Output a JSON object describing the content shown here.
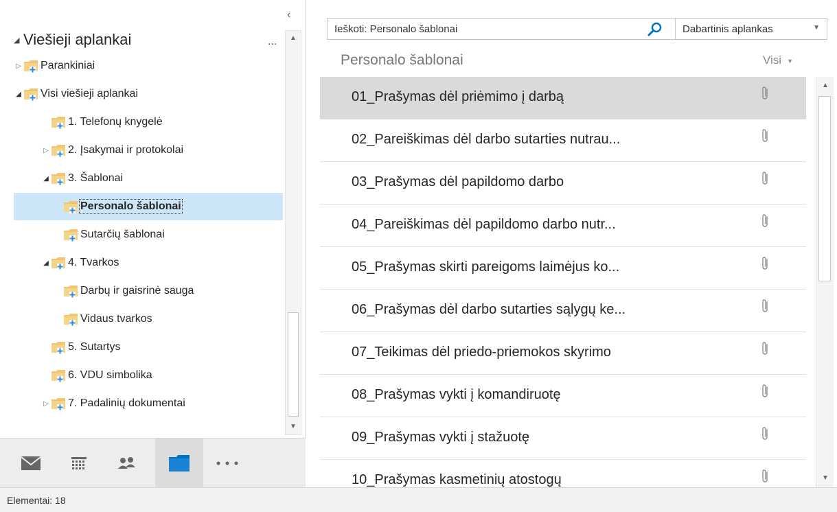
{
  "left_pane": {
    "collapse_glyph": "‹",
    "root_folder": {
      "caret": "◢",
      "label": "Viešieji aplankai",
      "more": "..."
    },
    "tree": [
      {
        "label": "Parankiniai",
        "caret": "▷",
        "indent": 0,
        "selected": false
      },
      {
        "label": "Visi viešieji aplankai",
        "caret": "◢",
        "indent": 0,
        "selected": false
      },
      {
        "label": "1. Telefonų knygelė",
        "caret": "",
        "indent": 1,
        "selected": false
      },
      {
        "label": "2. Įsakymai ir protokolai",
        "caret": "▷",
        "indent": 1,
        "selected": false
      },
      {
        "label": "3. Šablonai",
        "caret": "◢",
        "indent": 1,
        "selected": false
      },
      {
        "label": "Personalo šablonai",
        "caret": "",
        "indent": 2,
        "selected": true
      },
      {
        "label": "Sutarčių šablonai",
        "caret": "",
        "indent": 2,
        "selected": false
      },
      {
        "label": "4. Tvarkos",
        "caret": "◢",
        "indent": 1,
        "selected": false
      },
      {
        "label": "Darbų ir gaisrinė sauga",
        "caret": "",
        "indent": 2,
        "selected": false
      },
      {
        "label": "Vidaus tvarkos",
        "caret": "",
        "indent": 2,
        "selected": false
      },
      {
        "label": "5. Sutartys",
        "caret": "",
        "indent": 1,
        "selected": false
      },
      {
        "label": "6. VDU simbolika",
        "caret": "",
        "indent": 1,
        "selected": false
      },
      {
        "label": "7. Padalinių dokumentai",
        "caret": "▷",
        "indent": 1,
        "selected": false
      }
    ],
    "nav": [
      {
        "name": "mail-icon",
        "active": false
      },
      {
        "name": "calendar-icon",
        "active": false
      },
      {
        "name": "people-icon",
        "active": false
      },
      {
        "name": "folder-icon",
        "active": true
      },
      {
        "name": "more-icon",
        "active": false
      }
    ]
  },
  "search": {
    "placeholder": "Ieškoti: Personalo šablonai",
    "scope": "Dabartinis aplankas"
  },
  "list": {
    "title": "Personalo šablonai",
    "filter": "Visi",
    "items": [
      {
        "subject": "01_Prašymas dėl priėmimo į darbą",
        "selected": true,
        "attachment": true
      },
      {
        "subject": "02_Pareiškimas dėl darbo sutarties nutrau...",
        "selected": false,
        "attachment": true
      },
      {
        "subject": "03_Prašymas dėl papildomo darbo",
        "selected": false,
        "attachment": true
      },
      {
        "subject": "04_Pareiškimas dėl papildomo darbo nutr...",
        "selected": false,
        "attachment": true
      },
      {
        "subject": "05_Prašymas skirti pareigoms laimėjus ko...",
        "selected": false,
        "attachment": true
      },
      {
        "subject": "06_Prašymas dėl darbo sutarties sąlygų ke...",
        "selected": false,
        "attachment": true
      },
      {
        "subject": "07_Teikimas dėl priedo-priemokos skyrimo",
        "selected": false,
        "attachment": true
      },
      {
        "subject": "08_Prašymas vykti į komandiruotę",
        "selected": false,
        "attachment": true
      },
      {
        "subject": "09_Prašymas vykti į stažuotę",
        "selected": false,
        "attachment": true
      },
      {
        "subject": "10_Prašymas kasmetinių atostogų",
        "selected": false,
        "attachment": true
      }
    ]
  },
  "status": {
    "text": "Elementai: 18"
  },
  "colors": {
    "accent": "#0072c6",
    "folder": "#f2c46d",
    "folder_badge": "#2e8bd6",
    "selected_tree": "#cde6f7",
    "selected_row": "#dadada"
  }
}
